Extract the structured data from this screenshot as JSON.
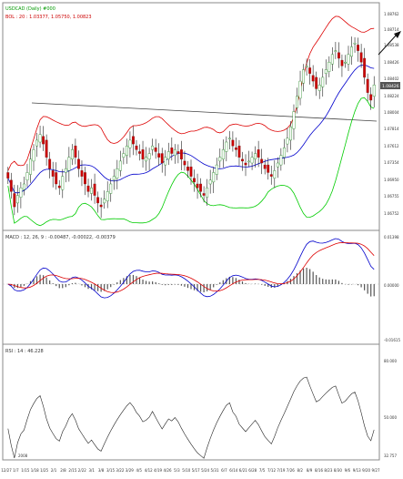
{
  "chart_data": [
    {
      "type": "candlestick",
      "title": "USDCAD (Daily) #000",
      "subtitle": "BOL : 20 : 1.03377, 1.05750, 1.00823",
      "ylim": [
        0.97,
        1.08
      ],
      "y_ticks": [
        "1.08762",
        "1.08714",
        "1.08538",
        "1.08426",
        "1.08402",
        "1.08224",
        "1.08004",
        "1.07814",
        "1.07612",
        "1.07354",
        "1.06950",
        "1.06755",
        "1.06752"
      ],
      "current_value_label": "1.08426",
      "closes": [
        0.995,
        0.988,
        0.98,
        0.986,
        0.99,
        0.992,
        0.998,
        1.005,
        1.01,
        1.015,
        1.018,
        1.013,
        1.006,
        1.0,
        0.996,
        0.992,
        0.99,
        0.996,
        1.0,
        1.006,
        1.01,
        1.006,
        1.0,
        0.996,
        0.992,
        0.988,
        0.99,
        0.986,
        0.982,
        0.98,
        0.984,
        0.988,
        0.992,
        0.996,
        1.0,
        1.004,
        1.008,
        1.012,
        1.015,
        1.013,
        1.01,
        1.008,
        1.005,
        1.006,
        1.008,
        1.012,
        1.009,
        1.006,
        1.003,
        1.006,
        1.009,
        1.008,
        1.01,
        1.008,
        1.005,
        1.002,
        0.999,
        0.996,
        0.993,
        0.99,
        0.988,
        0.986,
        0.99,
        0.994,
        0.998,
        1.002,
        1.006,
        1.01,
        1.014,
        1.016,
        1.012,
        1.01,
        1.006,
        1.004,
        1.002,
        1.004,
        1.006,
        1.008,
        1.006,
        1.003,
        1.0,
        0.998,
        0.996,
        0.999,
        1.003,
        1.007,
        1.011,
        1.016,
        1.022,
        1.03,
        1.038,
        1.046,
        1.052,
        1.054,
        1.05,
        1.046,
        1.042,
        1.044,
        1.048,
        1.052,
        1.056,
        1.06,
        1.062,
        1.058,
        1.054,
        1.056,
        1.06,
        1.064,
        1.066,
        1.062,
        1.056,
        1.048,
        1.04,
        1.036,
        1.044
      ]
    },
    {
      "type": "line",
      "title": "MACD : 12, 26, 9 : -0.00487, -0.00022, -0.00379",
      "y_ticks": [
        "0.01398",
        "0.00000",
        "-0.01615"
      ],
      "series": []
    },
    {
      "type": "line",
      "title": "RSI : 14 : 46.228",
      "ylim": [
        30,
        100
      ],
      "y_ticks": [
        "80.000",
        "50.000",
        "32.757"
      ],
      "series": []
    }
  ],
  "x_labels": [
    "12/27",
    "1/7",
    "1/15",
    "1/18",
    "1/25",
    "2/1",
    "2/8",
    "2/15",
    "2/22",
    "3/1",
    "3/8",
    "3/15",
    "3/22",
    "3/29",
    "4/5",
    "4/12",
    "4/19",
    "4/26",
    "5/3",
    "5/10",
    "5/17",
    "5/24",
    "5/31",
    "6/7",
    "6/14",
    "6/21",
    "6/28",
    "7/5",
    "7/12",
    "7/19",
    "7/26",
    "8/2",
    "8/9",
    "8/16",
    "8/23",
    "8/30",
    "9/6",
    "9/13",
    "9/20",
    "9/27"
  ],
  "rsi_bottom_label": "2008"
}
